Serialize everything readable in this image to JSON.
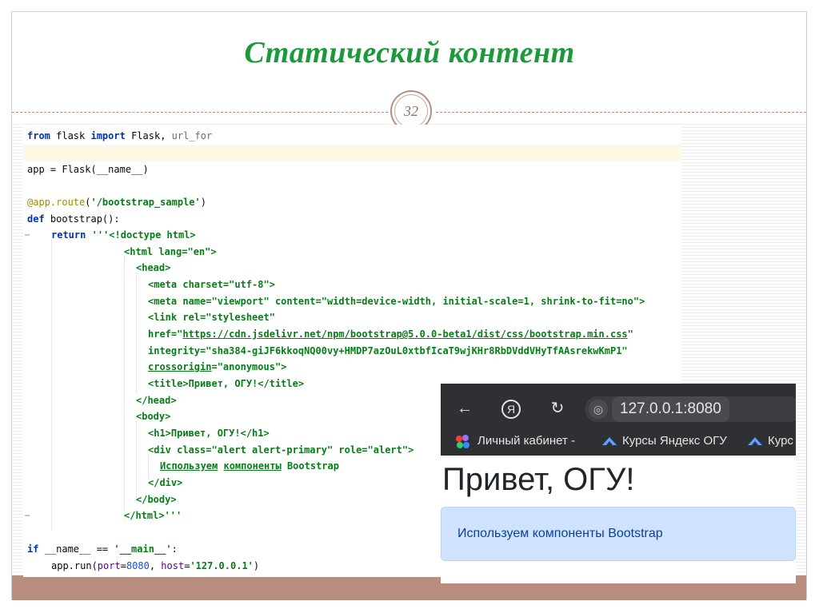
{
  "slide": {
    "title": "Статический контент",
    "page_number": "32",
    "colors": {
      "title": "#1a9a3a",
      "accent": "#b98e80"
    }
  },
  "code": {
    "l1": {
      "a": "from",
      "b": " flask ",
      "c": "import",
      "d": " Flask, ",
      "e": "url_for"
    },
    "l3": {
      "a": "app = Flask(__name__)"
    },
    "l5": {
      "a": "@app.route",
      "b": "(",
      "c": "'/bootstrap_sample'",
      "d": ")"
    },
    "l6": {
      "a": "def",
      "b": " bootstrap():"
    },
    "l7": {
      "a": "return",
      "b": " ",
      "c": "'''<!doctype html>"
    },
    "l8": "<html lang=\"en\">",
    "l9": "<head>",
    "l10": "<meta charset=\"utf-8\">",
    "l11": "<meta name=\"viewport\" content=\"width=device-width, initial-scale=1, shrink-to-fit=no\">",
    "l12": "<link rel=\"stylesheet\"",
    "l13": {
      "a": "href=\"",
      "b": "https://cdn.jsdelivr.net/npm/bootstrap@5.0.0-beta1/dist/css/bootstrap.min.css",
      "c": "\""
    },
    "l14": "integrity=\"sha384-giJF6kkoqNQ00vy+HMDP7azOuL0xtbfIcaT9wjKHr8RbDVddVHyTfAAsrekwKmP1\"",
    "l15": {
      "a": "crossorigin",
      "b": "=\"anonymous\">"
    },
    "l16": "<title>Привет, ОГУ!</title>",
    "l17": "</head>",
    "l18": "<body>",
    "l19": "<h1>Привет, ОГУ!</h1>",
    "l20": "<div class=\"alert alert-primary\" role=\"alert\">",
    "l21": {
      "a": "Используем",
      "b": " ",
      "c": "компоненты",
      "d": " Bootstrap"
    },
    "l22": "</div>",
    "l23": "</body>",
    "l24": "</html>'''",
    "l26": {
      "a": "if",
      "b": " __name__ == ",
      "c": "'__main__'",
      "d": ":"
    },
    "l27": {
      "a": "app.run(",
      "b": "port",
      "c": "=",
      "d": "8080",
      "e": ", ",
      "f": "host",
      "g": "=",
      "h": "'127.0.0.1'",
      "i": ")"
    }
  },
  "browser": {
    "url": "127.0.0.1:8080",
    "nav_icons": [
      "back-arrow-icon",
      "yandex-icon",
      "reload-icon",
      "globe-icon"
    ],
    "yandex_glyph": "Я",
    "bookmarks": [
      "Личный кабинет -",
      "Курсы Яндекс ОГУ",
      "Курс"
    ],
    "page_heading": "Привет, ОГУ!",
    "alert_text": "Используем компоненты Bootstrap",
    "colors": {
      "toolbar": "#2f3033",
      "alert_bg": "#cfe2ff",
      "alert_text": "#084298"
    }
  }
}
